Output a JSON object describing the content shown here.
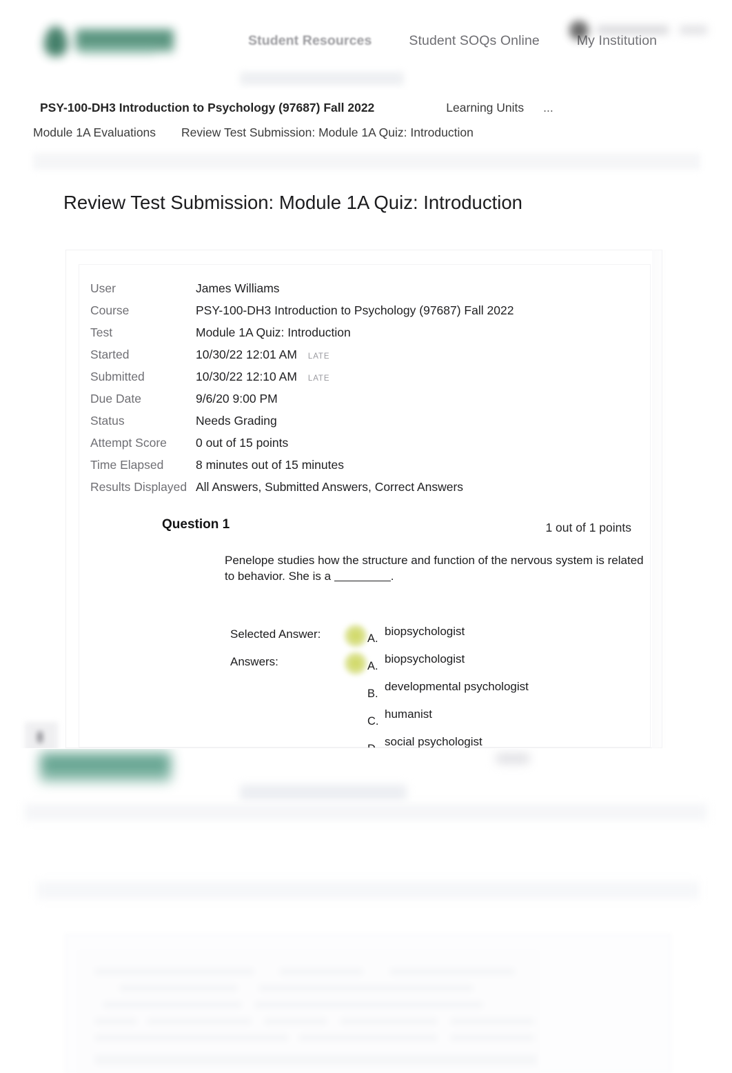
{
  "nav": {
    "brand_logo_alt": "institution-logo",
    "items": [
      {
        "label": "Student Resources",
        "active": true
      },
      {
        "label": "Student SOQs Online",
        "active": false
      },
      {
        "label": "My Institution",
        "active": false
      }
    ]
  },
  "breadcrumb": {
    "course_title": "PSY-100-DH3 Introduction to Psychology (97687) Fall 2022",
    "learning_units": "Learning Units",
    "ellipsis": "...",
    "parent": "Module 1A Evaluations",
    "current": "Review Test Submission: Module 1A Quiz: Introduction"
  },
  "page": {
    "heading": "Review Test Submission: Module 1A Quiz: Introduction"
  },
  "details": {
    "rows": [
      {
        "label": "User",
        "value": "James Williams",
        "badge": ""
      },
      {
        "label": "Course",
        "value": "PSY-100-DH3 Introduction to Psychology (97687) Fall 2022",
        "badge": ""
      },
      {
        "label": "Test",
        "value": "Module 1A Quiz: Introduction",
        "badge": ""
      },
      {
        "label": "Started",
        "value": "10/30/22 12:01 AM",
        "badge": "LATE"
      },
      {
        "label": "Submitted",
        "value": "10/30/22 12:10 AM",
        "badge": "LATE"
      },
      {
        "label": "Due Date",
        "value": "9/6/20 9:00 PM",
        "badge": ""
      },
      {
        "label": "Status",
        "value": "Needs Grading",
        "badge": ""
      },
      {
        "label": "Attempt Score",
        "value": "0 out of 15 points",
        "badge": ""
      },
      {
        "label": "Time Elapsed",
        "value": "8 minutes out of 15 minutes",
        "badge": ""
      },
      {
        "label": "Results Displayed",
        "value": "All Answers, Submitted Answers, Correct Answers",
        "badge": ""
      }
    ]
  },
  "question": {
    "title": "Question 1",
    "points": "1 out of 1 points",
    "text_before_blank": "Penelope studies how the structure and function of the nervous system is related to behavior. She is a ",
    "text_after_blank": ".",
    "selected_answer_label": "Selected Answer:",
    "answers_label": "Answers:",
    "selected_answer": {
      "letter": "A.",
      "text": "biopsychologist",
      "correct_marker": true
    },
    "options": [
      {
        "letter": "A.",
        "text": "biopsychologist",
        "correct_marker": true
      },
      {
        "letter": "B.",
        "text": "developmental psychologist",
        "correct_marker": false
      },
      {
        "letter": "C.",
        "text": "humanist",
        "correct_marker": false
      },
      {
        "letter": "D.",
        "text": "social psychologist",
        "correct_marker": false
      }
    ]
  },
  "colors": {
    "brand_green": "#3c7a63",
    "correct_marker": "#d4dd6e",
    "nav_text": "#6e6e73",
    "body_text": "#1c1c1e",
    "muted_label": "#6f6f74"
  }
}
